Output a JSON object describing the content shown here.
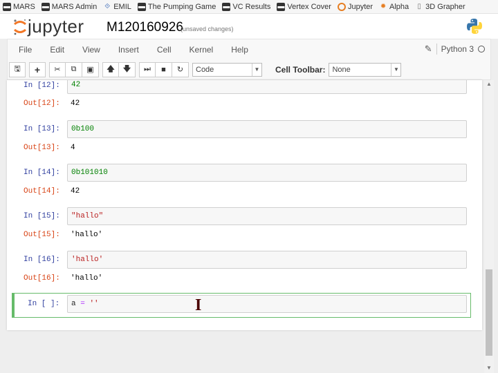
{
  "bookmarks": [
    {
      "label": "MARS",
      "icon": "folder-icon"
    },
    {
      "label": "MARS Admin",
      "icon": "folder-icon"
    },
    {
      "label": "EMIL",
      "icon": "emil-icon"
    },
    {
      "label": "The Pumping Game",
      "icon": "folder-icon"
    },
    {
      "label": "VC Results",
      "icon": "folder-icon"
    },
    {
      "label": "Vertex Cover",
      "icon": "folder-icon"
    },
    {
      "label": "Jupyter",
      "icon": "jupyter-icon"
    },
    {
      "label": "Alpha",
      "icon": "alpha-icon"
    },
    {
      "label": "3D Grapher",
      "icon": "page-icon"
    }
  ],
  "header": {
    "logo_text": "jupyter",
    "notebook_name": "M120160926",
    "save_status": "(unsaved changes)"
  },
  "menu": [
    "File",
    "Edit",
    "View",
    "Insert",
    "Cell",
    "Kernel",
    "Help"
  ],
  "kernel": {
    "name": "Python 3"
  },
  "toolbar": {
    "cell_type": "Code",
    "cell_toolbar_label": "Cell Toolbar:",
    "cell_toolbar_value": "None"
  },
  "cells": [
    {
      "in_prompt": "In [12]:",
      "source": "42",
      "out_prompt": "Out[12]:",
      "output": "42"
    },
    {
      "in_prompt": "In [13]:",
      "source": "0b100",
      "out_prompt": "Out[13]:",
      "output": "4"
    },
    {
      "in_prompt": "In [14]:",
      "source": "0b101010",
      "out_prompt": "Out[14]:",
      "output": "42"
    },
    {
      "in_prompt": "In [15]:",
      "source": "\"hallo\"",
      "out_prompt": "Out[15]:",
      "output": "'hallo'"
    },
    {
      "in_prompt": "In [16]:",
      "source": "'hallo'",
      "out_prompt": "Out[16]:",
      "output": "'hallo'"
    }
  ],
  "active_cell": {
    "in_prompt": "In [ ]:",
    "var": "a",
    "op": "=",
    "value": "''"
  },
  "colors": {
    "in_prompt": "#303f9f",
    "out_prompt": "#d84315",
    "number": "#008000",
    "string": "#ba2121",
    "selected_border": "#66bb6a"
  }
}
